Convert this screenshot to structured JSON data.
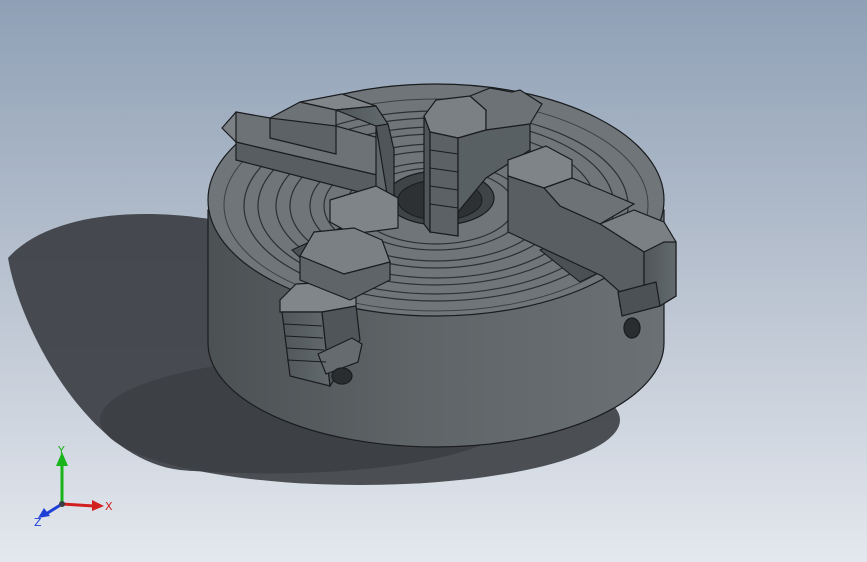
{
  "viewport": {
    "colors": {
      "body": "#5d6265",
      "top_face": "#6f7579",
      "jaw": "#6c7276",
      "edge": "#1a1c1e",
      "shadow": "#3c3f44"
    }
  },
  "triad": {
    "x_label": "X",
    "y_label": "Y",
    "z_label": "Z",
    "colors": {
      "x": "#d21f1f",
      "y": "#19b419",
      "z": "#1d3fd6"
    }
  }
}
